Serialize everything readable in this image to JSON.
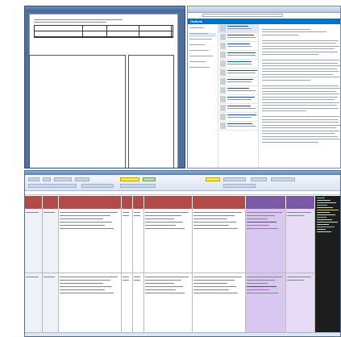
{
  "document": {
    "title": "",
    "header_text": "",
    "lines": [
      "",
      "",
      ""
    ]
  },
  "email": {
    "app_label": "Outlook",
    "folders": [
      "",
      "",
      "",
      "",
      "",
      "",
      "",
      ""
    ],
    "messages": [
      {
        "from": "",
        "subject": ""
      },
      {
        "from": "",
        "subject": ""
      },
      {
        "from": "",
        "subject": ""
      },
      {
        "from": "",
        "subject": ""
      },
      {
        "from": "",
        "subject": ""
      },
      {
        "from": "",
        "subject": ""
      },
      {
        "from": "",
        "subject": ""
      },
      {
        "from": "",
        "subject": ""
      },
      {
        "from": "",
        "subject": ""
      },
      {
        "from": "",
        "subject": ""
      },
      {
        "from": "",
        "subject": ""
      },
      {
        "from": "",
        "subject": ""
      }
    ]
  },
  "spreadsheet": {
    "headers": [
      "",
      "",
      "",
      "",
      "",
      "",
      "",
      "",
      ""
    ],
    "rows": [
      [
        "",
        "",
        "",
        "",
        "",
        "",
        "",
        "",
        ""
      ],
      [
        "",
        "",
        "",
        "",
        "",
        "",
        "",
        "",
        ""
      ]
    ]
  },
  "colors": {
    "accent_blue": "#0072c6",
    "header_red": "#b34a4a",
    "header_purple": "#7a5aa6",
    "cell_purple": "#d9c7ef",
    "cell_lavender": "#e6dcf5",
    "terminal_bg": "#1d1d1d"
  }
}
